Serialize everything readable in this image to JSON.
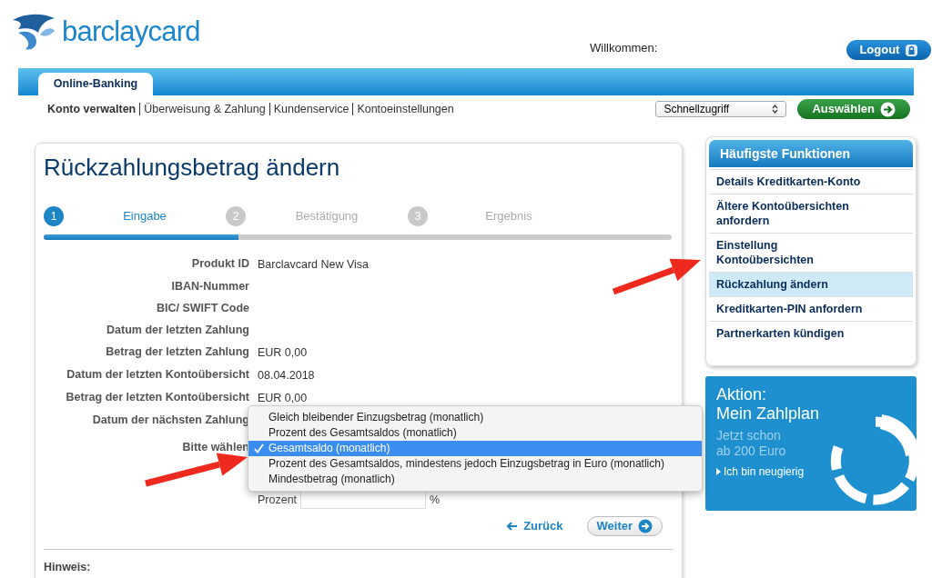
{
  "header": {
    "logo": "barclaycard",
    "welcome": "Willkommen:",
    "logout": "Logout"
  },
  "tabs": [
    {
      "label": "Online-Banking",
      "selected": true
    }
  ],
  "nav": [
    {
      "label": "Konto verwalten",
      "selected": true
    },
    {
      "label": "Überweisung & Zahlung",
      "selected": false
    },
    {
      "label": "Kundenservice",
      "selected": false
    },
    {
      "label": "Kontoeinstellungen",
      "selected": false
    }
  ],
  "quick_access": {
    "value": "Schnellzugriff",
    "button": "Auswählen"
  },
  "main": {
    "title": "Rückzahlungsbetrag ändern",
    "steps": [
      {
        "number": "1",
        "label": "Eingabe",
        "selected": true
      },
      {
        "number": "2",
        "label": "Bestätigung",
        "selected": false
      },
      {
        "number": "3",
        "label": "Ergebnis",
        "selected": false
      }
    ],
    "progress": {
      "level": 0.31
    },
    "fields": [
      {
        "label": "Produkt ID",
        "value": "Barclavcard New Visa"
      },
      {
        "label": "IBAN-Nummer"
      },
      {
        "label": "BIC/ SWIFT Code"
      },
      {
        "label": "Datum der letzten Zahlung"
      },
      {
        "label": "Betrag der letzten Zahlung",
        "value": "EUR 0,00"
      },
      {
        "label": "Datum der letzten Kontoübersicht",
        "value": "08.04.2018"
      },
      {
        "label": "Betrag der letzten Kontoübersicht",
        "value": "EUR 0,00"
      },
      {
        "label": "Datum der nächsten Zahlung"
      }
    ],
    "choice_label": "Bitte wählen",
    "menu": [
      {
        "label": "Gleich bleibender Einzugsbetrag (monatlich)",
        "selected": false
      },
      {
        "label": "Prozent des Gesamtsaldos (monatlich)",
        "selected": false
      },
      {
        "label": "Gesamtsaldo (monatlich)",
        "selected": true
      },
      {
        "label": "Prozent des Gesamtsaldos, mindestens jedoch Einzugsbetrag in Euro (monatlich)",
        "selected": false
      },
      {
        "label": "Mindestbetrag (monatlich)",
        "selected": false
      }
    ],
    "percent": {
      "label": "Prozent",
      "unit": "%"
    },
    "back": "Zurück",
    "next": "Weiter",
    "note": "Hinweis:"
  },
  "sidebar": {
    "title": "Häufigste Funktionen",
    "items": [
      {
        "label": "Details Kreditkarten-Konto",
        "selected": false
      },
      {
        "label": "Ältere Kontoübersichten anfordern",
        "selected": false
      },
      {
        "label": "Einstellung Kontoübersichten",
        "selected": false
      },
      {
        "label": "Rückzahlung ändern",
        "selected": true
      },
      {
        "label": "Kreditkarten-PIN anfordern",
        "selected": false
      },
      {
        "label": "Partnerkarten kündigen",
        "selected": false
      }
    ]
  },
  "promo": {
    "title": "Aktion:",
    "subtitle": "Mein Zahlplan",
    "lines": [
      "Jetzt schon",
      "ab 200 Euro"
    ],
    "link": "Ich bin neugierig"
  }
}
